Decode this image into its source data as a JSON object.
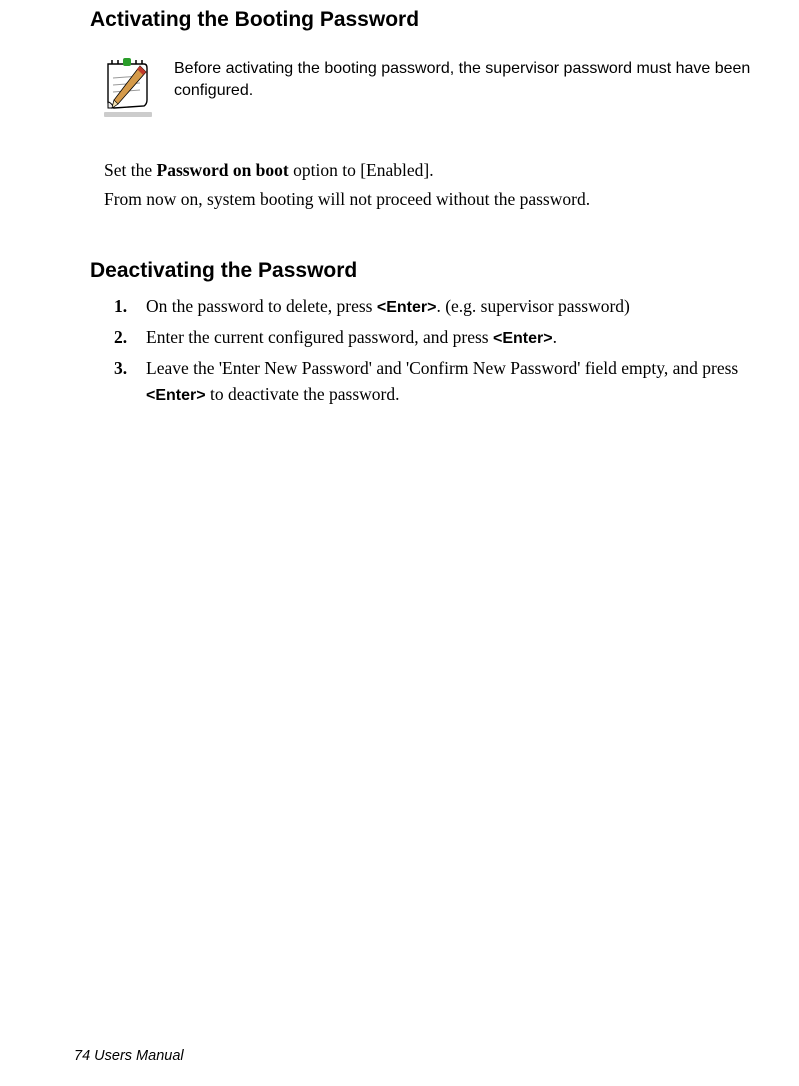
{
  "section1": {
    "title": "Activating the Booting Password",
    "noteText": "Before activating the booting password, the supervisor password must have been configured.",
    "body1_a": "Set the ",
    "body1_bold": "Password on boot",
    "body1_b": " option to [Enabled].",
    "body2": "From now on, system booting will not proceed without the password."
  },
  "section2": {
    "title": "Deactivating the Password",
    "steps": [
      {
        "num": "1.",
        "a": "On the password to delete, press ",
        "enter": "<Enter>",
        "b": ". (e.g. supervisor password)"
      },
      {
        "num": "2.",
        "a": "Enter the current configured password, and press ",
        "enter": "<Enter>",
        "b": "."
      },
      {
        "num": "3.",
        "a": "Leave the 'Enter New Password' and 'Confirm New Password' field empty, and press ",
        "enter": "<Enter>",
        "b": " to deactivate the password."
      }
    ]
  },
  "footer": "74  Users Manual"
}
